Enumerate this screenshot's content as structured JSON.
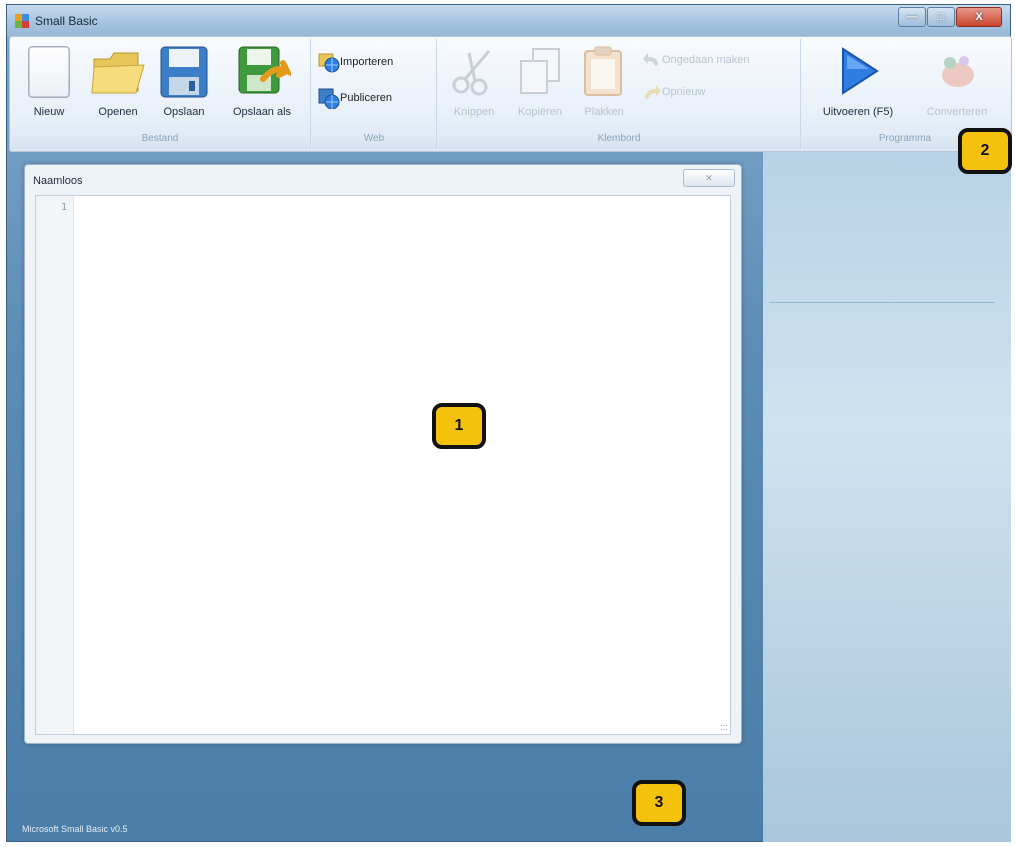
{
  "window": {
    "title": "Small Basic",
    "controls": {
      "minimize": "—",
      "maximize": "□",
      "close": "X"
    }
  },
  "ribbon": {
    "groups": {
      "bestand": {
        "label": "Bestand",
        "buttons": {
          "new": "Nieuw",
          "open": "Openen",
          "save": "Opslaan",
          "save_as": "Opslaan als"
        }
      },
      "web": {
        "label": "Web",
        "buttons": {
          "import": "Importeren",
          "publish": "Publiceren"
        }
      },
      "klembord": {
        "label": "Klembord",
        "buttons": {
          "cut": "Knippen",
          "copy": "Kopiëren",
          "paste": "Plakken",
          "undo": "Ongedaan maken",
          "redo": "Opnieuw"
        }
      },
      "programma": {
        "label": "Programma",
        "buttons": {
          "run": "Uitvoeren (F5)",
          "convert": "Converteren"
        }
      }
    }
  },
  "editor": {
    "title": "Naamloos",
    "line_numbers": [
      "1"
    ],
    "code": ""
  },
  "status": {
    "text": "Microsoft Small Basic v0.5"
  },
  "badges": [
    "1",
    "2",
    "3"
  ],
  "colors": {
    "badge_fill": "#f4c20d",
    "run_accent": "#2f7de0"
  }
}
